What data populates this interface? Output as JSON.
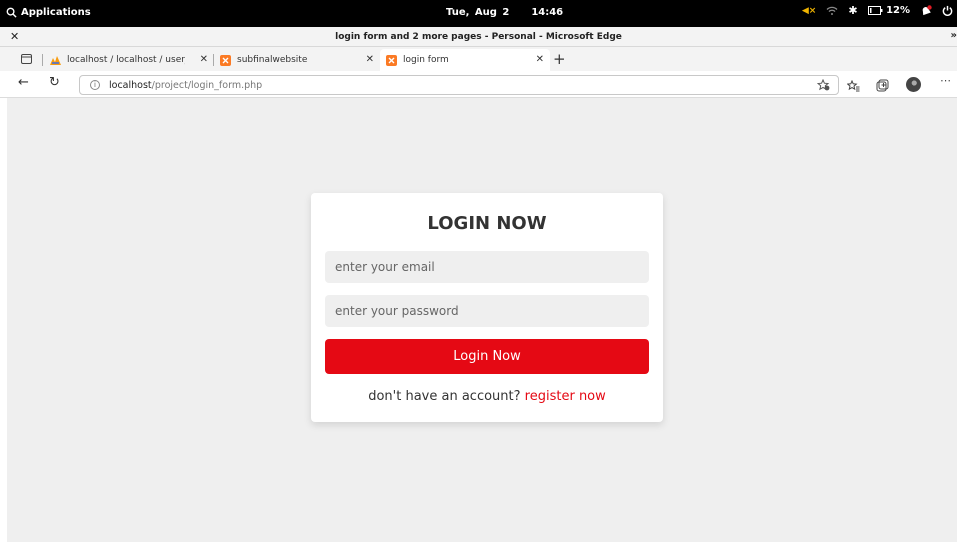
{
  "topbar": {
    "applications": "Applications",
    "date": "Tue, Aug 2",
    "time": "14:46",
    "battery": "12%"
  },
  "window": {
    "title": "login form and 2 more pages - Personal - Microsoft Edge"
  },
  "tabs": [
    {
      "label": "localhost / localhost / user_db /",
      "favicon": "phpmyadmin-icon"
    },
    {
      "label": "subfinalwebsite",
      "favicon": "xampp-icon"
    },
    {
      "label": "login form",
      "favicon": "xampp-icon",
      "active": true
    }
  ],
  "address": {
    "host": "localhost",
    "path": "/project/login_form.php"
  },
  "form": {
    "heading": "login now",
    "email_placeholder": "enter your email",
    "password_placeholder": "enter your password",
    "submit_label": "Login Now",
    "prompt": "don't have an account?",
    "register_link": "register now"
  },
  "colors": {
    "accent": "#e50914",
    "page_bg": "#efefef"
  }
}
